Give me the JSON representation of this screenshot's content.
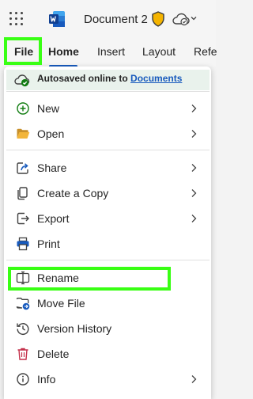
{
  "app": {
    "title": "Document 2"
  },
  "tabs": [
    {
      "label": "File"
    },
    {
      "label": "Home"
    },
    {
      "label": "Insert"
    },
    {
      "label": "Layout"
    },
    {
      "label": "Refe"
    }
  ],
  "autosave": {
    "text": "Autosaved online to",
    "link": "Documents"
  },
  "menu": {
    "items": [
      {
        "label": "New",
        "icon": "plus-circle-icon",
        "has_submenu": true
      },
      {
        "label": "Open",
        "icon": "folder-open-icon",
        "has_submenu": true
      },
      {
        "label": "Share",
        "icon": "share-icon",
        "has_submenu": true
      },
      {
        "label": "Create a Copy",
        "icon": "copy-icon",
        "has_submenu": true
      },
      {
        "label": "Export",
        "icon": "export-icon",
        "has_submenu": true
      },
      {
        "label": "Print",
        "icon": "print-icon",
        "has_submenu": false
      },
      {
        "label": "Rename",
        "icon": "rename-icon",
        "has_submenu": false
      },
      {
        "label": "Move File",
        "icon": "move-file-icon",
        "has_submenu": false
      },
      {
        "label": "Version History",
        "icon": "history-icon",
        "has_submenu": false
      },
      {
        "label": "Delete",
        "icon": "trash-icon",
        "has_submenu": false
      },
      {
        "label": "Info",
        "icon": "info-icon",
        "has_submenu": true
      }
    ]
  },
  "colors": {
    "accent": "#185abd",
    "highlight": "#39ff14",
    "delete": "#c4314b",
    "autosave_bg": "#e9f2ec"
  }
}
